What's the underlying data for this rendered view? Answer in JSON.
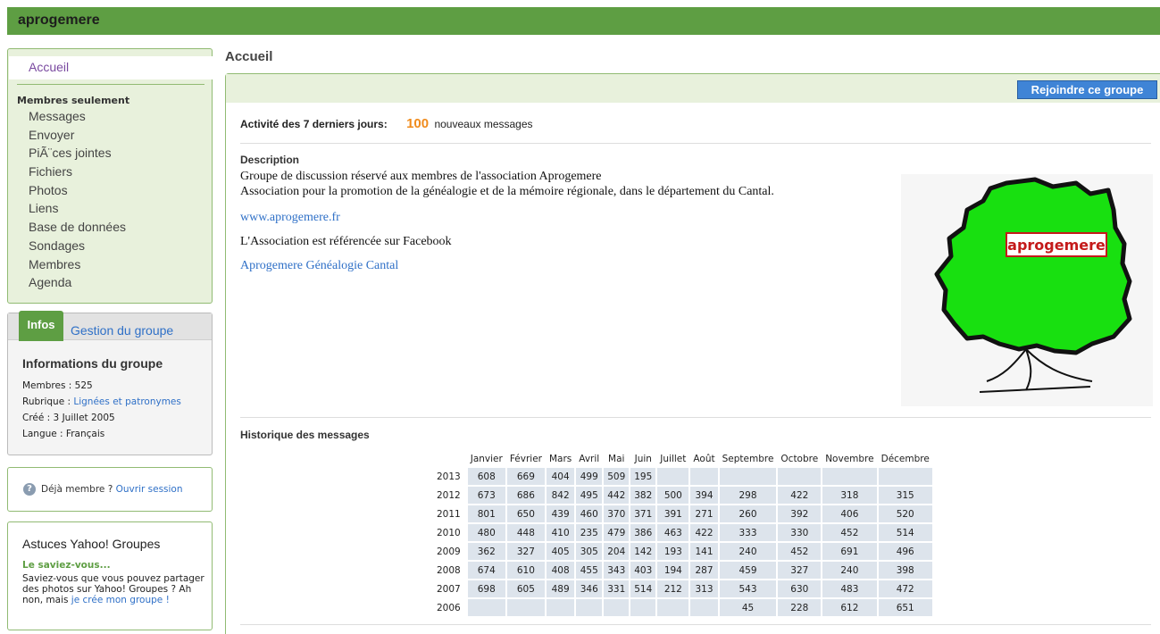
{
  "app": {
    "title": "aprogemere"
  },
  "nav": {
    "home": "Accueil",
    "section": "Membres seulement",
    "items": [
      "Messages",
      "Envoyer",
      "PiÃ¨ces jointes",
      "Fichiers",
      "Photos",
      "Liens",
      "Base de données",
      "Sondages",
      "Membres",
      "Agenda"
    ]
  },
  "info": {
    "tab_active": "Infos",
    "tab_other": "Gestion du groupe",
    "heading": "Informations du groupe",
    "members_label": "Membres : ",
    "members_value": "525",
    "category_label": "Rubrique : ",
    "category_value": "Lignées et patronymes",
    "created": "Créé : 3 Juillet 2005",
    "language": "Langue : Français"
  },
  "login": {
    "text": "Déjà membre ? ",
    "link": "Ouvrir session"
  },
  "tips": {
    "heading": "Astuces Yahoo! Groupes",
    "lead": "Le saviez-vous...",
    "body": "Saviez-vous que vous pouvez partager des photos sur Yahoo! Groupes ? Ah non, mais ",
    "link": "je crée mon groupe !"
  },
  "main": {
    "title": "Accueil",
    "join_button": "Rejoindre ce groupe",
    "activity_label": "Activité des 7 derniers jours:",
    "activity_count": "100",
    "activity_suffix": "nouveaux messages",
    "description_heading": "Description",
    "description_line1": "Groupe de discussion réservé aux membres de l'association Aprogemere",
    "description_line2": "Association pour la promotion de la généalogie et de la mémoire régionale, dans le département du Cantal.",
    "website": "www.aprogemere.fr",
    "facebook_note": "L'Association est référencée sur Facebook",
    "facebook_link": "Aprogemere Généalogie Cantal",
    "logo_text": "aprogemere",
    "history_heading": "Historique des messages"
  },
  "history": {
    "months": [
      "Janvier",
      "Février",
      "Mars",
      "Avril",
      "Mai",
      "Juin",
      "Juillet",
      "Août",
      "Septembre",
      "Octobre",
      "Novembre",
      "Décembre"
    ],
    "rows": [
      {
        "year": "2013",
        "values": [
          "608",
          "669",
          "404",
          "499",
          "509",
          "195",
          "",
          "",
          "",
          "",
          "",
          ""
        ]
      },
      {
        "year": "2012",
        "values": [
          "673",
          "686",
          "842",
          "495",
          "442",
          "382",
          "500",
          "394",
          "298",
          "422",
          "318",
          "315"
        ]
      },
      {
        "year": "2011",
        "values": [
          "801",
          "650",
          "439",
          "460",
          "370",
          "371",
          "391",
          "271",
          "260",
          "392",
          "406",
          "520"
        ]
      },
      {
        "year": "2010",
        "values": [
          "480",
          "448",
          "410",
          "235",
          "479",
          "386",
          "463",
          "422",
          "333",
          "330",
          "452",
          "514"
        ]
      },
      {
        "year": "2009",
        "values": [
          "362",
          "327",
          "405",
          "305",
          "204",
          "142",
          "193",
          "141",
          "240",
          "452",
          "691",
          "496"
        ]
      },
      {
        "year": "2008",
        "values": [
          "674",
          "610",
          "408",
          "455",
          "343",
          "403",
          "194",
          "287",
          "459",
          "327",
          "240",
          "398"
        ]
      },
      {
        "year": "2007",
        "values": [
          "698",
          "605",
          "489",
          "346",
          "331",
          "514",
          "212",
          "313",
          "543",
          "630",
          "483",
          "472"
        ]
      },
      {
        "year": "2006",
        "values": [
          "",
          "",
          "",
          "",
          "",
          "",
          "",
          "",
          "45",
          "228",
          "612",
          "651"
        ]
      }
    ]
  },
  "colors": {
    "brand_green": "#5e9e43",
    "button_blue": "#3f84d6",
    "accent_orange": "#f08b1c"
  }
}
